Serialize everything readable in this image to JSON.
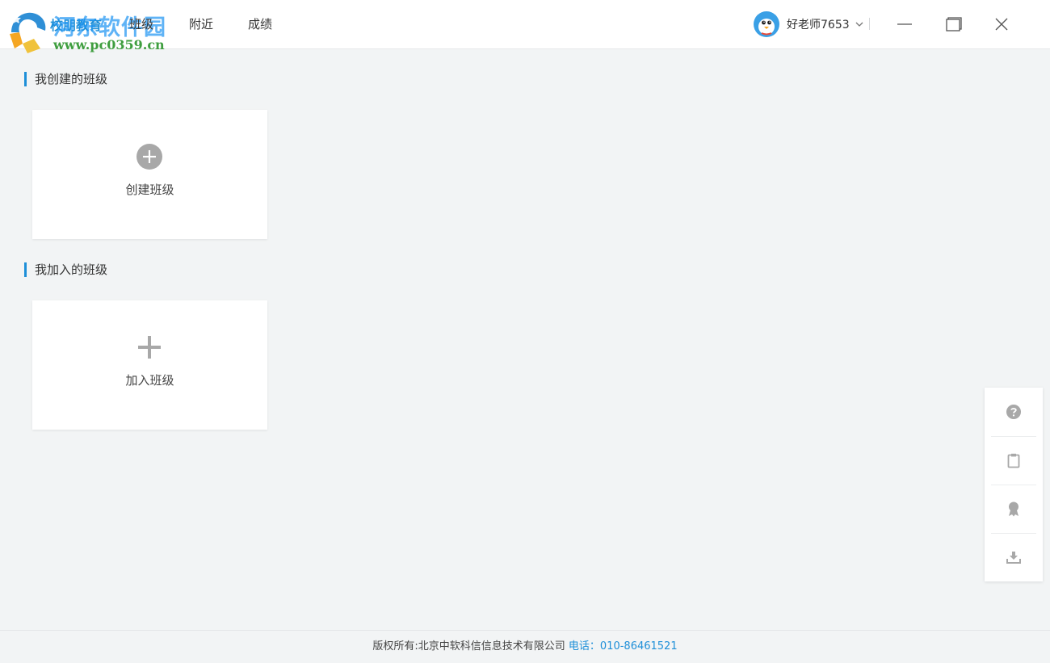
{
  "logo": {
    "brand": "校朋教育",
    "watermark": "河东软件园",
    "url": "www.pc0359.cn"
  },
  "nav": {
    "items": [
      {
        "label": "班级"
      },
      {
        "label": "附近"
      },
      {
        "label": "成绩"
      }
    ]
  },
  "user": {
    "name": "好老师7653",
    "avatar_icon": "penguin-avatar-icon"
  },
  "window_controls": [
    "minimize-icon",
    "maximize-icon",
    "close-icon"
  ],
  "sections": [
    {
      "title": "我创建的班级",
      "card": {
        "label": "创建班级",
        "icon": "plus-circle-icon"
      }
    },
    {
      "title": "我加入的班级",
      "card": {
        "label": "加入班级",
        "icon": "plus-icon"
      }
    }
  ],
  "float_tools": [
    "help-icon",
    "clipboard-icon",
    "award-icon",
    "download-icon"
  ],
  "footer": {
    "copyright": "版权所有:北京中软科信信息技术有限公司",
    "phone": "电话：010-86461521"
  },
  "colors": {
    "accent": "#1e8fd8",
    "background": "#f2f4f5",
    "card": "#ffffff",
    "icon_gray": "#a8a8a8"
  }
}
